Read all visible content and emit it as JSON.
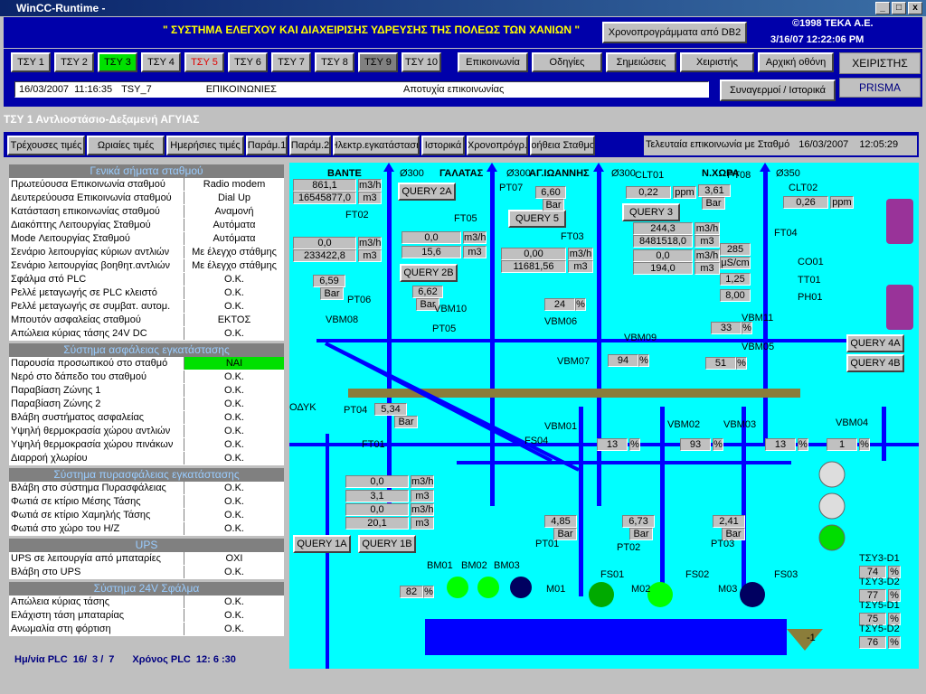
{
  "window": {
    "title": "WinCC-Runtime -",
    "min": "_",
    "max": "□",
    "close": "x"
  },
  "header": {
    "title": "\" ΣΥΣΤΗΜΑ ΕΛΕΓΧΟΥ ΚΑΙ ΔΙΑΧΕΙΡΙΣΗΣ ΥΔΡΕΥΣΗΣ ΤΗΣ ΠΟΛΕΩΣ ΤΩΝ ΧΑΝΙΩΝ \"",
    "schedule_btn": "Χρονοπρογράμματα από DB2",
    "copyright": "©1998 ΤΕΚΑ Α.Ε.",
    "datetime": "3/16/07 12:22:06 PM"
  },
  "nav": {
    "stations": [
      {
        "label": "ΤΣΥ 1",
        "style": "normal"
      },
      {
        "label": "ΤΣΥ 2",
        "style": "normal"
      },
      {
        "label": "ΤΣΥ 3",
        "style": "green"
      },
      {
        "label": "ΤΣΥ 4",
        "style": "normal"
      },
      {
        "label": "ΤΣΥ 5",
        "style": "red"
      },
      {
        "label": "ΤΣΥ 6",
        "style": "normal"
      },
      {
        "label": "ΤΣΥ 7",
        "style": "normal"
      },
      {
        "label": "ΤΣΥ 8",
        "style": "normal"
      },
      {
        "label": "ΤΣΥ 9",
        "style": "dark"
      },
      {
        "label": "ΤΣΥ 10",
        "style": "normal"
      }
    ],
    "comms": "Επικοινωνία",
    "instr": "Οδηγίες",
    "notes": "Σημειώσεις",
    "operator": "Χειριστής",
    "home": "Αρχική οθόνη",
    "user": "ΧΕΙΡΙΣΤΗΣ",
    "prisma": "PRISMA",
    "alarms": "Συναγερμοί / Ιστορικά",
    "alarm_line": {
      "date": "16/03/2007",
      "time": "11:16:35",
      "source": "TSY_7",
      "type": "ΕΠΙΚΟΙΝΩΝΙΕΣ",
      "msg": "Αποτυχία επικοινωνίας"
    }
  },
  "section_title": "ΤΣΥ 1 Αντλιοστάσιο-Δεξαμενή ΑΓΥΙΑΣ",
  "tabs": [
    "Τρέχουσες τιμές",
    "Ωριαίες τιμές",
    "Ημερήσιες τιμές",
    "Παράμ.1",
    "Παράμ.2",
    "Ηλεκτρ.εγκατάσταση",
    "Ιστορικά",
    "Χρονοπρόγρ.",
    "Βοήθεια Σταθμού"
  ],
  "last_comm": {
    "label": "Τελευταία επικοινωνία με Σταθμό",
    "date": "16/03/2007",
    "time": "12:05:29"
  },
  "groups": [
    {
      "title": "Γενικά σήματα σταθμού",
      "rows": [
        [
          "Πρωτεύουσα Επικοινωνία σταθμού",
          "Radio modem"
        ],
        [
          "Δευτερεύουσα Επικοινωνία σταθμού",
          "Dial Up"
        ],
        [
          "Κατάσταση επικοινωνίας σταθμού",
          "Αναμονή"
        ],
        [
          "Διακόπτης Λειτουργίας Σταθμού",
          "Αυτόματα"
        ],
        [
          "Mode Λειτουργίας Σταθμού",
          "Αυτόματα"
        ],
        [
          "Σενάριο λειτουργίας κύριων αντλιών",
          "Με έλεγχο στάθμης"
        ],
        [
          "Σενάριο λειτουργίας βοηθητ.αντλιών",
          "Με έλεγχο στάθμης"
        ],
        [
          "Σφάλμα στό PLC",
          "O.K."
        ],
        [
          "Ρελλέ μεταγωγής σε PLC κλειστό",
          "O.K."
        ],
        [
          "Ρελλέ μεταγωγής σε συμβατ. αυτομ.",
          "O.K."
        ],
        [
          "Μπουτόν ασφαλείας σταθμού",
          "ΕΚΤΟΣ"
        ],
        [
          "Απώλεια κύριας τάσης 24V DC",
          "O.K."
        ]
      ]
    },
    {
      "title": "Σύστημα ασφάλειας εγκατάστασης",
      "rows": [
        [
          "Παρουσία προσωπικού στο σταθμό",
          "ΝΑΙ"
        ],
        [
          "Νερό στο δάπεδο του σταθμού",
          "O.K."
        ],
        [
          "Παραβίαση Ζώνης 1",
          "O.K."
        ],
        [
          "Παραβίαση Ζώνης 2",
          "O.K."
        ],
        [
          "Βλάβη συστήματος ασφαλείας",
          "O.K."
        ],
        [
          "Υψηλή θερμοκρασία χώρου αντλιών",
          "O.K."
        ],
        [
          "Υψηλή θερμοκρασία χώρου πινάκων",
          "O.K."
        ],
        [
          "Διαρροή χλωρίου",
          "O.K."
        ]
      ]
    },
    {
      "title": "Σύστημα πυρασφάλειας εγκατάστασης",
      "rows": [
        [
          "Βλάβη στο σύστημα Πυρασφάλειας",
          "O.K."
        ],
        [
          "Φωτιά σε κτίριο Μέσης Τάσης",
          "O.K."
        ],
        [
          "Φωτιά σε κτίριο Χαμηλής Τάσης",
          "O.K."
        ],
        [
          "Φωτιά στο χώρο του Η/Ζ",
          "O.K."
        ]
      ]
    },
    {
      "title": "UPS",
      "rows": [
        [
          "UPS σε λειτουργία από μπαταρίες",
          "ΟΧΙ"
        ],
        [
          "Βλάβη στο UPS",
          "O.K."
        ]
      ]
    },
    {
      "title": "Σύστημα 24V Σφάλμα",
      "rows": [
        [
          "Απώλεια κύριας τάσης",
          "O.K."
        ],
        [
          "Ελάχιστη τάση μπαταρίας",
          "O.K."
        ],
        [
          "Ανωμαλία στη φόρτιση",
          "O.K."
        ]
      ]
    }
  ],
  "plc": {
    "date_label": "Ημ/νία PLC",
    "d": "16/",
    "m": "3 /",
    "y": "7",
    "time_label": "Χρόνος PLC",
    "time": "12: 6 :30"
  },
  "mimic": {
    "lines": {
      "bante": "ΒΑΝΤΕ",
      "galatas": "ΓΑΛΑΤΑΣ",
      "agioann": "ΑΓ.ΙΩΑΝΝΗΣ",
      "nxora": "Ν.ΧΩΡΑ",
      "d300a": "Ø300",
      "d300b": "Ø300",
      "d300c": "Ø300",
      "d350": "Ø350",
      "odyk": "ΟΔΥΚ"
    },
    "tags": {
      "ft02": "FT02",
      "ft05": "FT05",
      "ft03": "FT03",
      "ft04": "FT04",
      "ft01": "FT01",
      "pt07": "PT07",
      "pt06": "PT06",
      "pt05": "PT05",
      "pt04": "PT04",
      "pt08": "PT08",
      "pt01": "PT01",
      "pt02": "PT02",
      "pt03": "PT03",
      "clt01": "CLT01",
      "clt02": "CLT02",
      "co01": "CO01",
      "tt01": "TT01",
      "ph01": "PH01",
      "vbm08": "VBM08",
      "vbm10": "VBM10",
      "vbm06": "VBM06",
      "vbm09": "VBM09",
      "vbm11": "VBM11",
      "vbm05": "VBM05",
      "vbm07": "VBM07",
      "vbm01": "VBM01",
      "vbm02": "VBM02",
      "vbm03": "VBM03",
      "vbm04": "VBM04",
      "fs04": "FS04",
      "fs01": "FS01",
      "fs02": "FS02",
      "fs03": "FS03",
      "m01": "M01",
      "m02": "M02",
      "m03": "M03",
      "bm01": "BM01",
      "bm02": "BM02",
      "bm03": "BM03",
      "m": "M"
    },
    "queries": {
      "q2a": "QUERY 2A",
      "q5": "QUERY 5",
      "q3": "QUERY 3",
      "q2b": "QUERY 2B",
      "q4a": "QUERY 4A",
      "q4b": "QUERY 4B",
      "q1a": "QUERY 1A",
      "q1b": "QUERY 1B"
    },
    "ft02": {
      "flow": "861,1",
      "fu": "m3/h",
      "tot": "16545877,0",
      "tu": "m3",
      "flow2": "0,0",
      "f2u": "m3/h",
      "tot2": "233422,8",
      "t2u": "m3"
    },
    "ft05": {
      "flow": "0,0",
      "fu": "m3/h",
      "tot": "15,6",
      "tu": "m3"
    },
    "ft03": {
      "flow": "244,3",
      "fu": "m3/h",
      "tot": "8481518,0",
      "tu": "m3",
      "flow2": "0,00",
      "f2u": "m3/h",
      "tot2": "11681,56",
      "t2u": "m3",
      "flow3": "0,0",
      "f3u": "m3/h",
      "tot3": "194,0",
      "t3u": "m3"
    },
    "pt07": {
      "v": "6,60",
      "u": "Bar"
    },
    "clt01": {
      "v": "0,22",
      "u": "ppm"
    },
    "pt08": {
      "v": "3,61",
      "u": "Bar"
    },
    "clt02": {
      "v": "0,26",
      "u": "ppm"
    },
    "co01": {
      "v": "285",
      "u": "μS/cm"
    },
    "tt01": {
      "v": "1,25"
    },
    "ph01": {
      "v": "8,00"
    },
    "pt06": {
      "v": "6,59",
      "u": "Bar"
    },
    "pt05": {
      "v": "6,62",
      "u": "Bar"
    },
    "pt04": {
      "v": "5,34",
      "u": "Bar"
    },
    "vbm06": {
      "v": "24",
      "u": "%"
    },
    "vbm11": {
      "v": "33",
      "u": "%"
    },
    "vbm05": {
      "v": "51",
      "u": "%"
    },
    "vbm07": {
      "v": "94",
      "u": "%"
    },
    "vbm01": {
      "v": "13",
      "u": "%"
    },
    "vbm02": {
      "v": "93",
      "u": "%"
    },
    "vbm03": {
      "v": "13",
      "u": "%"
    },
    "vbm04": {
      "v": "1",
      "u": "%"
    },
    "ft01": {
      "flow": "0,0",
      "fu": "m3/h",
      "tot": "3,1",
      "tu": "m3",
      "flow2": "0,0",
      "f2u": "m3/h",
      "tot2": "20,1",
      "t2u": "m3"
    },
    "pt01": {
      "v": "4,85",
      "u": "Bar"
    },
    "pt02": {
      "v": "6,73",
      "u": "Bar"
    },
    "pt03": {
      "v": "2,41",
      "u": "Bar"
    },
    "level": {
      "v": "82",
      "u": "%"
    },
    "tank_val": "-1",
    "tsy": [
      {
        "l": "ΤΣΥ3-D1",
        "v": "74",
        "u": "%"
      },
      {
        "l": "ΤΣΥ3-D2",
        "v": "77",
        "u": "%"
      },
      {
        "l": "ΤΣΥ5-D1",
        "v": "75",
        "u": "%"
      },
      {
        "l": "ΤΣΥ5-D2",
        "v": "76",
        "u": "%"
      }
    ]
  }
}
